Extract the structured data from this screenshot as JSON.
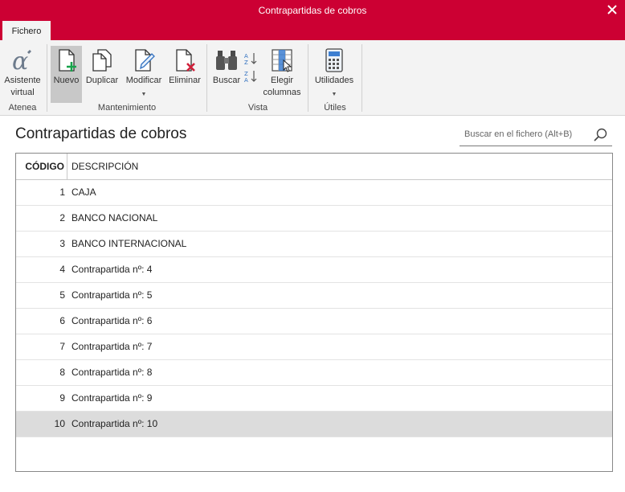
{
  "window": {
    "title": "Contrapartidas de cobros"
  },
  "tabs": [
    {
      "label": "Fichero"
    }
  ],
  "ribbon": {
    "groups": [
      {
        "label": "Atenea"
      },
      {
        "label": "Mantenimiento"
      },
      {
        "label": "Vista"
      },
      {
        "label": "Útiles"
      }
    ],
    "buttons": [
      {
        "label": "Asistente virtual",
        "icon": "alpha-assistant-icon"
      },
      {
        "label": "Nuevo",
        "icon": "new-document-icon"
      },
      {
        "label": "Duplicar",
        "icon": "duplicate-icon"
      },
      {
        "label": "Modificar",
        "icon": "edit-document-icon"
      },
      {
        "label": "Eliminar",
        "icon": "delete-document-icon"
      },
      {
        "label": "Buscar",
        "icon": "binoculars-icon"
      },
      {
        "label": "Elegir columnas",
        "icon": "choose-columns-icon"
      },
      {
        "label": "Utilidades",
        "icon": "calculator-icon"
      }
    ]
  },
  "page": {
    "title": "Contrapartidas de cobros"
  },
  "search": {
    "placeholder": "Buscar en el fichero (Alt+B)"
  },
  "grid": {
    "columns": [
      "CÓDIGO",
      "DESCRIPCIÓN"
    ],
    "rows": [
      {
        "code": "1",
        "desc": "CAJA"
      },
      {
        "code": "2",
        "desc": "BANCO NACIONAL"
      },
      {
        "code": "3",
        "desc": "BANCO INTERNACIONAL"
      },
      {
        "code": "4",
        "desc": "Contrapartida nº: 4"
      },
      {
        "code": "5",
        "desc": "Contrapartida nº: 5"
      },
      {
        "code": "6",
        "desc": "Contrapartida nº: 6"
      },
      {
        "code": "7",
        "desc": "Contrapartida nº: 7"
      },
      {
        "code": "8",
        "desc": "Contrapartida nº: 8"
      },
      {
        "code": "9",
        "desc": "Contrapartida nº: 9"
      },
      {
        "code": "10",
        "desc": "Contrapartida nº: 10"
      }
    ],
    "selected_row": 10
  },
  "colors": {
    "accent": "#cc0033",
    "ribbon_bg": "#f3f3f3",
    "selected_row": "#dcdcdc"
  }
}
